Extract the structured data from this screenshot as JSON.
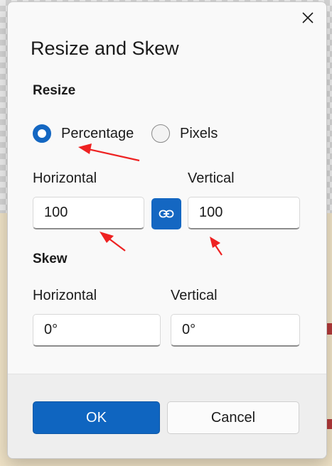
{
  "dialog": {
    "title": "Resize and Skew",
    "close_icon": "close-icon"
  },
  "resize": {
    "section_label": "Resize",
    "mode_options": [
      {
        "label": "Percentage",
        "selected": true
      },
      {
        "label": "Pixels",
        "selected": false
      }
    ],
    "horizontal_label": "Horizontal",
    "horizontal_value": "100",
    "vertical_label": "Vertical",
    "vertical_value": "100",
    "lock_aspect_icon": "link-icon"
  },
  "skew": {
    "section_label": "Skew",
    "horizontal_label": "Horizontal",
    "horizontal_value": "0°",
    "vertical_label": "Vertical",
    "vertical_value": "0°"
  },
  "footer": {
    "ok_label": "OK",
    "cancel_label": "Cancel"
  },
  "colors": {
    "accent": "#1467c2",
    "annotation": "#ee2222"
  }
}
